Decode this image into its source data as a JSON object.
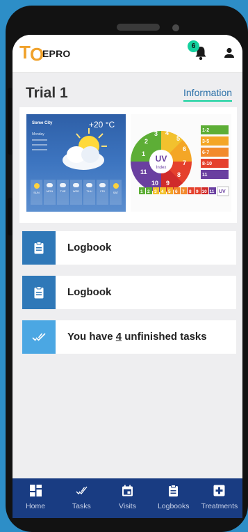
{
  "app": {
    "logo_letter_t": "T",
    "logo_letter_o": "O",
    "logo_name": "EPRO",
    "notifications_count": "6",
    "accent_color": "#14d19e",
    "brand_color": "#f0a22c",
    "nav_color": "#193c82"
  },
  "page": {
    "title": "Trial 1",
    "info_link": "Information"
  },
  "weather_image": {
    "city": "Some City",
    "day": "Monday",
    "temperature": "+20 °C",
    "days": [
      "SUN",
      "MON",
      "TUE",
      "WED",
      "THU",
      "FRI",
      "SAT"
    ]
  },
  "uv_image": {
    "center_title": "UV",
    "center_subtitle": "Index",
    "wheel_numbers": [
      "1",
      "2",
      "3",
      "4",
      "5",
      "6",
      "7",
      "8",
      "9",
      "10",
      "11"
    ],
    "legend": [
      "1-2",
      "3-5",
      "6-7",
      "8-10",
      "11"
    ],
    "scale": [
      "1",
      "2",
      "3",
      "4",
      "5",
      "6",
      "7",
      "8",
      "9",
      "10",
      "11"
    ],
    "scale_tag": "UV"
  },
  "cards": [
    {
      "label": "Logbook",
      "icon": "clipboard-icon"
    },
    {
      "label": "Logbook",
      "icon": "clipboard-icon"
    },
    {
      "prefix": "You have ",
      "count": "4",
      "suffix": " unfinished tasks",
      "icon": "double-check-icon"
    }
  ],
  "nav": [
    {
      "label": "Home",
      "icon": "dashboard-icon"
    },
    {
      "label": "Tasks",
      "icon": "double-check-icon"
    },
    {
      "label": "Visits",
      "icon": "calendar-icon"
    },
    {
      "label": "Logbooks",
      "icon": "clipboard-icon"
    },
    {
      "label": "Treatments",
      "icon": "medical-plus-icon"
    }
  ]
}
